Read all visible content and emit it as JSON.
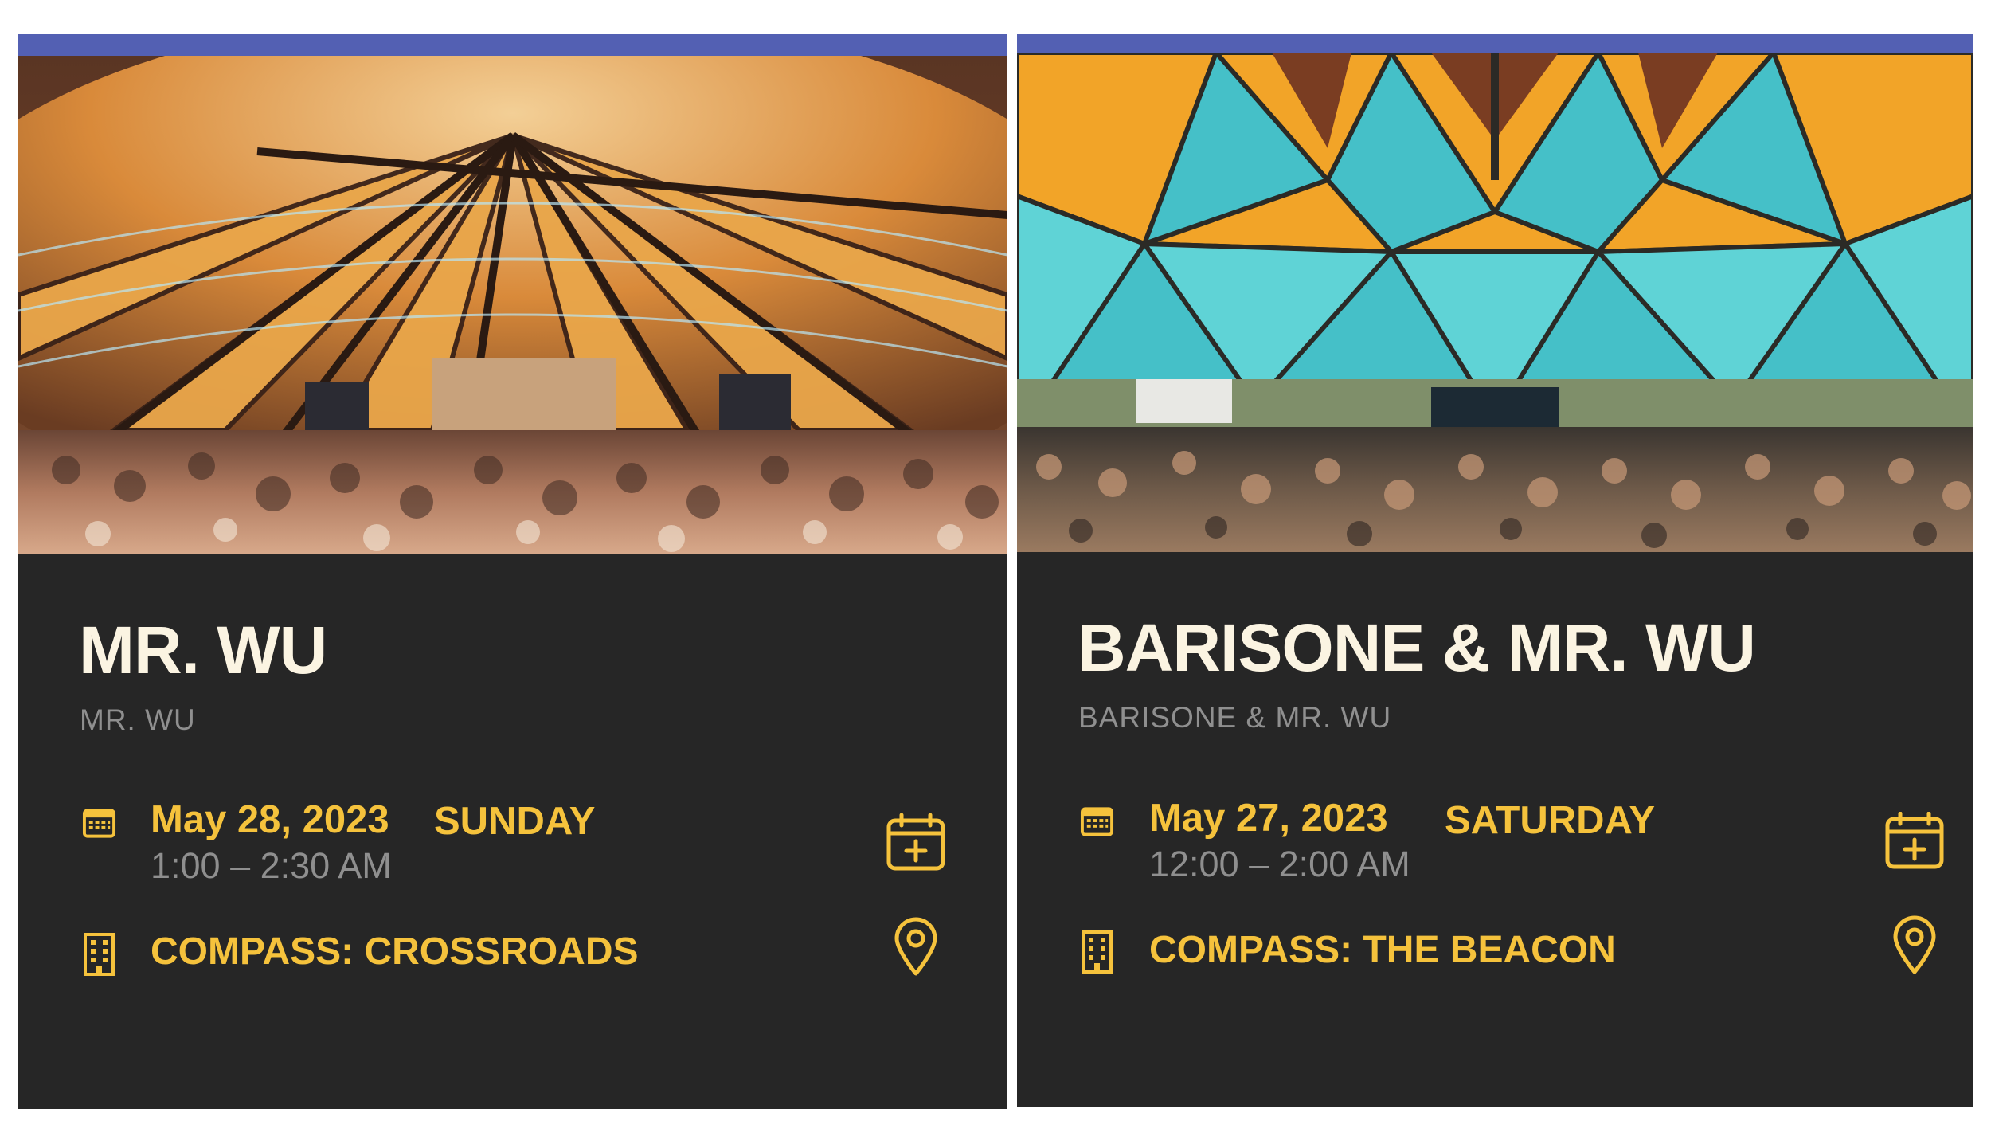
{
  "colors": {
    "card_background": "#262626",
    "top_bar": "#5360b3",
    "accent": "#f5c23c",
    "title": "#fbf4e2",
    "muted": "#8f8f8f"
  },
  "events": [
    {
      "title": "MR. WU",
      "artist": "MR. WU",
      "date": "May 28, 2023",
      "weekday": "SUNDAY",
      "time": "1:00 – 2:30 AM",
      "venue": "COMPASS: CROSSROADS",
      "icons": {
        "date": "calendar-icon",
        "venue": "building-icon",
        "add_to_calendar": "calendar-add-icon",
        "map": "location-pin-icon"
      }
    },
    {
      "title": "BARISONE & MR. WU",
      "artist": "BARISONE & MR. WU",
      "date": "May 27, 2023",
      "weekday": "SATURDAY",
      "time": "12:00 – 2:00 AM",
      "venue": "COMPASS: THE BEACON",
      "icons": {
        "date": "calendar-icon",
        "venue": "building-icon",
        "add_to_calendar": "calendar-add-icon",
        "map": "location-pin-icon"
      }
    }
  ]
}
